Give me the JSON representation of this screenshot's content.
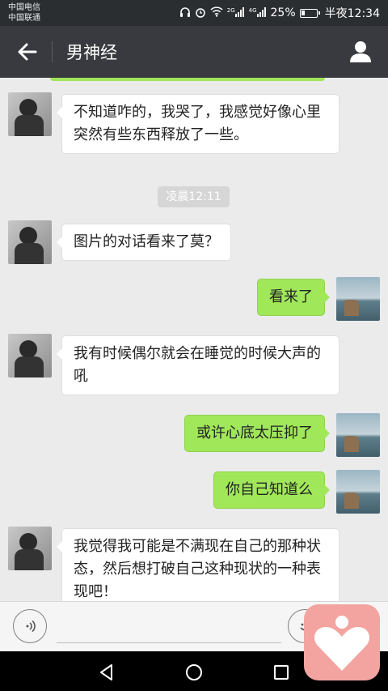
{
  "status_bar": {
    "carrier1": "中国电信",
    "carrier2": "中国联通",
    "network1": "2G",
    "network2": "4G",
    "battery": "25%",
    "time": "半夜12:34"
  },
  "header": {
    "title": "男神经"
  },
  "messages": [
    {
      "side": "in",
      "text": "不知道咋的，我哭了，我感觉好像心里突然有些东西释放了一些。"
    },
    {
      "side": "in",
      "text": "图片的对话看来了莫？"
    },
    {
      "side": "out",
      "text": "看来了"
    },
    {
      "side": "in",
      "text": "我有时候偶尔就会在睡觉的时候大声的吼"
    },
    {
      "side": "out",
      "text": "或许心底太压抑了"
    },
    {
      "side": "out",
      "text": "你自己知道么"
    },
    {
      "side": "in",
      "text": "我觉得我可能是不满现在自己的那种状态，然后想打破自己这种现状的一种表现吧！"
    }
  ],
  "timestamp": "凌晨12:11",
  "icons": {
    "back": "arrow-left-icon",
    "profile": "person-icon",
    "voice": "voice-icon",
    "emoji": "emoji-icon",
    "app_logo": "heart-person-logo"
  },
  "colors": {
    "outgoing_bubble": "#a0e75a",
    "incoming_bubble": "#ffffff",
    "title_bar": "#393a3f",
    "logo_bg": "#f3a4a0"
  }
}
